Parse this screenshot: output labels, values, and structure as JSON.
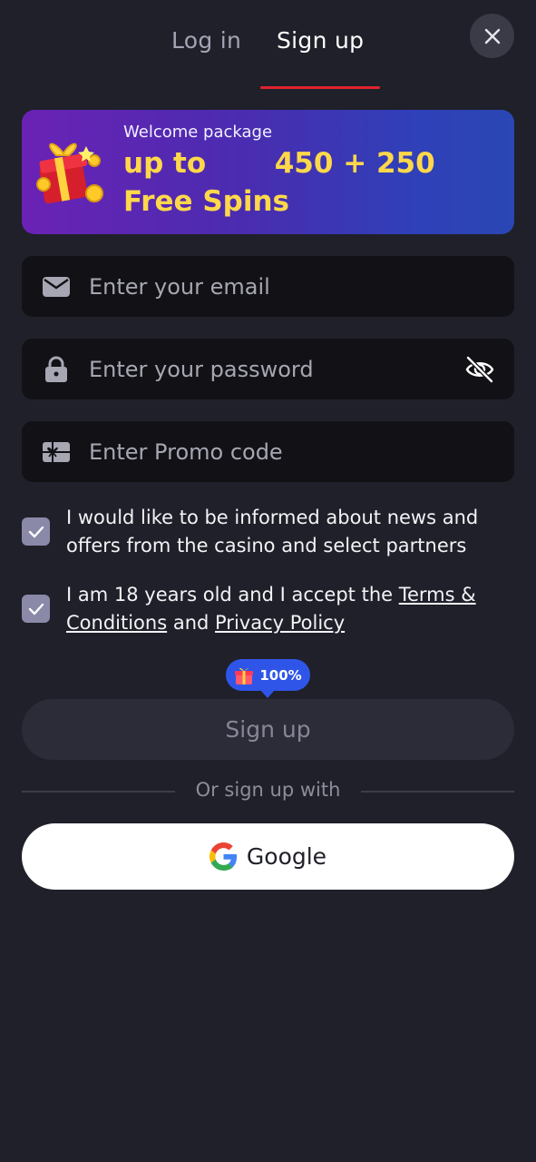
{
  "tabs": {
    "login": "Log in",
    "signup": "Sign up",
    "active": "signup"
  },
  "banner": {
    "kicker": "Welcome package",
    "main": "up to       450 + 250 Free Spins"
  },
  "form": {
    "email_placeholder": "Enter your email",
    "password_placeholder": "Enter your password",
    "promo_placeholder": "Enter Promo code",
    "consent_news": "I would like to be informed about news and offers from the casino and select partners",
    "consent_age_prefix": "I am 18 years old and I accept the ",
    "terms_link": "Terms & Conditions",
    "consent_and": " and ",
    "privacy_link": "Privacy Policy",
    "consent_news_checked": true,
    "consent_age_checked": true
  },
  "bonus": {
    "percent": "100%"
  },
  "submit": {
    "label": "Sign up"
  },
  "social": {
    "divider_text": "Or sign up with",
    "google_label": "Google"
  },
  "icons": {
    "close": "close-icon",
    "email": "envelope-icon",
    "password": "lock-icon",
    "visibility": "eye-off-icon",
    "promo": "gift-card-icon",
    "check": "checkmark-icon",
    "bonus": "gift-icon",
    "google": "google-logo-icon"
  },
  "colors": {
    "background": "#1f2029",
    "accent": "#e0232f",
    "banner_text": "#ffd84a",
    "bonus_pill": "#2f55e8",
    "checkbox": "#8b89a8"
  }
}
